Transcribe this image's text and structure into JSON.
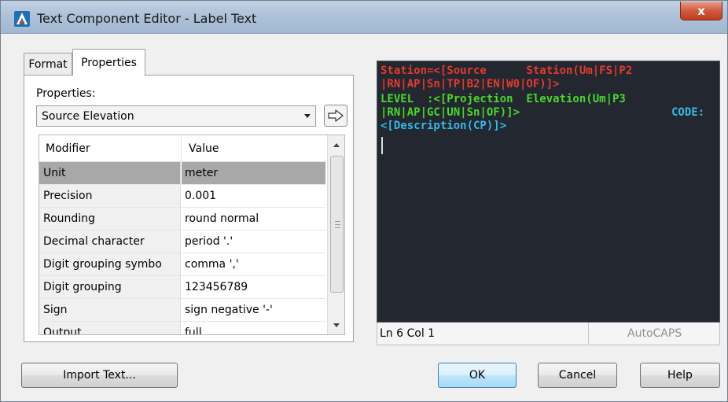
{
  "window": {
    "title": "Text Component Editor - Label Text",
    "close_glyph": "x"
  },
  "tabs": [
    {
      "label": "Format",
      "active": false
    },
    {
      "label": "Properties",
      "active": true
    }
  ],
  "properties_panel": {
    "label": "Properties:",
    "selected_property": "Source Elevation"
  },
  "grid": {
    "headers": {
      "modifier": "Modifier",
      "value": "Value"
    },
    "rows": [
      {
        "modifier": "Unit",
        "value": "meter",
        "selected": true
      },
      {
        "modifier": "Precision",
        "value": "0.001"
      },
      {
        "modifier": "Rounding",
        "value": "round normal"
      },
      {
        "modifier": "Decimal character",
        "value": "period '.'"
      },
      {
        "modifier": "Digit grouping symbo",
        "value": "comma ','"
      },
      {
        "modifier": "Digit grouping",
        "value": "123456789"
      },
      {
        "modifier": "Sign",
        "value": "sign negative '-'"
      },
      {
        "modifier": "Output",
        "value": "full"
      }
    ]
  },
  "editor": {
    "lines": [
      {
        "text": "Station=<[Source      Station(Um|FS|P2",
        "color": "#e43b2e"
      },
      {
        "text": "|RN|AP|Sn|TP|B2|EN|W0|OF)]>",
        "color": "#e43b2e"
      },
      {
        "text": "LEVEL  :<[Projection  Elevation(Um|P3",
        "color": "#4bd92b"
      },
      {
        "text": "|RN|AP|GC|UN|Sn|OF)]>             ",
        "color": "#4bd92b"
      },
      {
        "text": "<[Description(CP)]>",
        "color": "#37b9e8"
      }
    ],
    "code_label": "CODE:",
    "status_position": "Ln 6 Col 1",
    "status_caps": "AutoCAPS"
  },
  "buttons": {
    "import": "Import Text...",
    "ok": "OK",
    "cancel": "Cancel",
    "help": "Help"
  },
  "colors": {
    "editor_background": "#222730",
    "red_text": "#e43b2e",
    "green_text": "#4bd92b",
    "cyan_text": "#37b9e8",
    "selected_row": "#a8a8a8"
  },
  "icons": {
    "app": "autocad-a-icon",
    "insert_arrow": "arrow-right-icon"
  }
}
